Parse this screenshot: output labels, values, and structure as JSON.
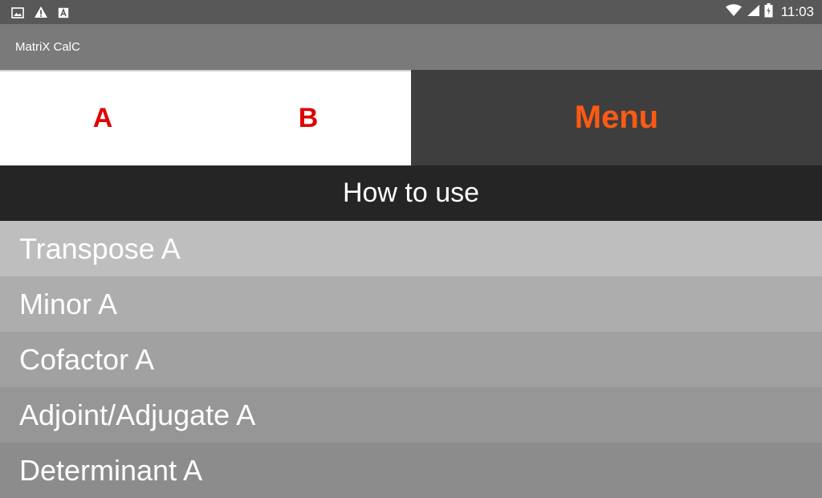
{
  "status_bar": {
    "time": "11:03",
    "left_icons": [
      "image-icon",
      "warning-icon",
      "font-icon"
    ],
    "right_icons": [
      "wifi-icon",
      "signal-icon",
      "battery-icon"
    ]
  },
  "app_bar": {
    "title": "MatriX CalC"
  },
  "tabs": {
    "a_label": "A",
    "b_label": "B",
    "menu_label": "Menu"
  },
  "how_to_use": {
    "label": "How to use"
  },
  "menu_items": [
    {
      "label": "Transpose A",
      "bg": "#bebebe"
    },
    {
      "label": "Minor A",
      "bg": "#adadad"
    },
    {
      "label": "Cofactor A",
      "bg": "#a1a1a1"
    },
    {
      "label": "Adjoint/Adjugate A",
      "bg": "#969696"
    },
    {
      "label": "Determinant A",
      "bg": "#8c8c8c"
    }
  ],
  "colors": {
    "tab_label": "#e00000",
    "menu_label": "#ff5a14",
    "status_bar": "#585858",
    "app_bar": "#7a7a7a"
  }
}
